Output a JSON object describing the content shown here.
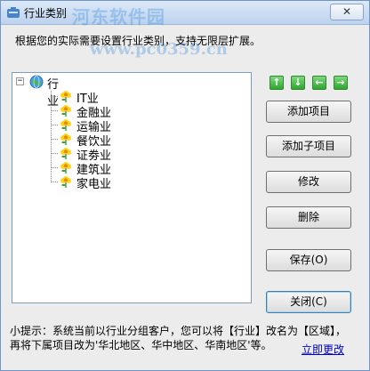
{
  "window": {
    "title": "行业类别",
    "close_symbol": "✕",
    "watermark": "河东软件园",
    "watermark_url": "www.pc0359.cn"
  },
  "description": "根据您的实际需要设置行业类别，支持无限层扩展。",
  "tree": {
    "root_label": "行业",
    "expander_symbol": "−",
    "items": [
      {
        "label": "IT业"
      },
      {
        "label": "金融业"
      },
      {
        "label": "运输业"
      },
      {
        "label": "餐饮业"
      },
      {
        "label": "证劵业"
      },
      {
        "label": "建筑业"
      },
      {
        "label": "家电业"
      }
    ]
  },
  "arrows": {
    "up": "↑",
    "down": "↓",
    "left": "←",
    "right": "→"
  },
  "buttons": {
    "add_item": "添加项目",
    "add_child": "添加子项目",
    "edit": "修改",
    "delete": "删除",
    "save": "保存(O)",
    "close": "关闭(C)"
  },
  "tip": {
    "line1": "小提示：系统当前以行业分组客户，您可以将【行业】改名为【区域】，",
    "line2": "再将下属项目改为'华北地区、华中地区、华南地区'等。"
  },
  "link_text": "立即更改",
  "colors": {
    "accent_green": "#2fa52f",
    "link_blue": "#0000c8",
    "watermark_blue": "#3c8cdc"
  }
}
